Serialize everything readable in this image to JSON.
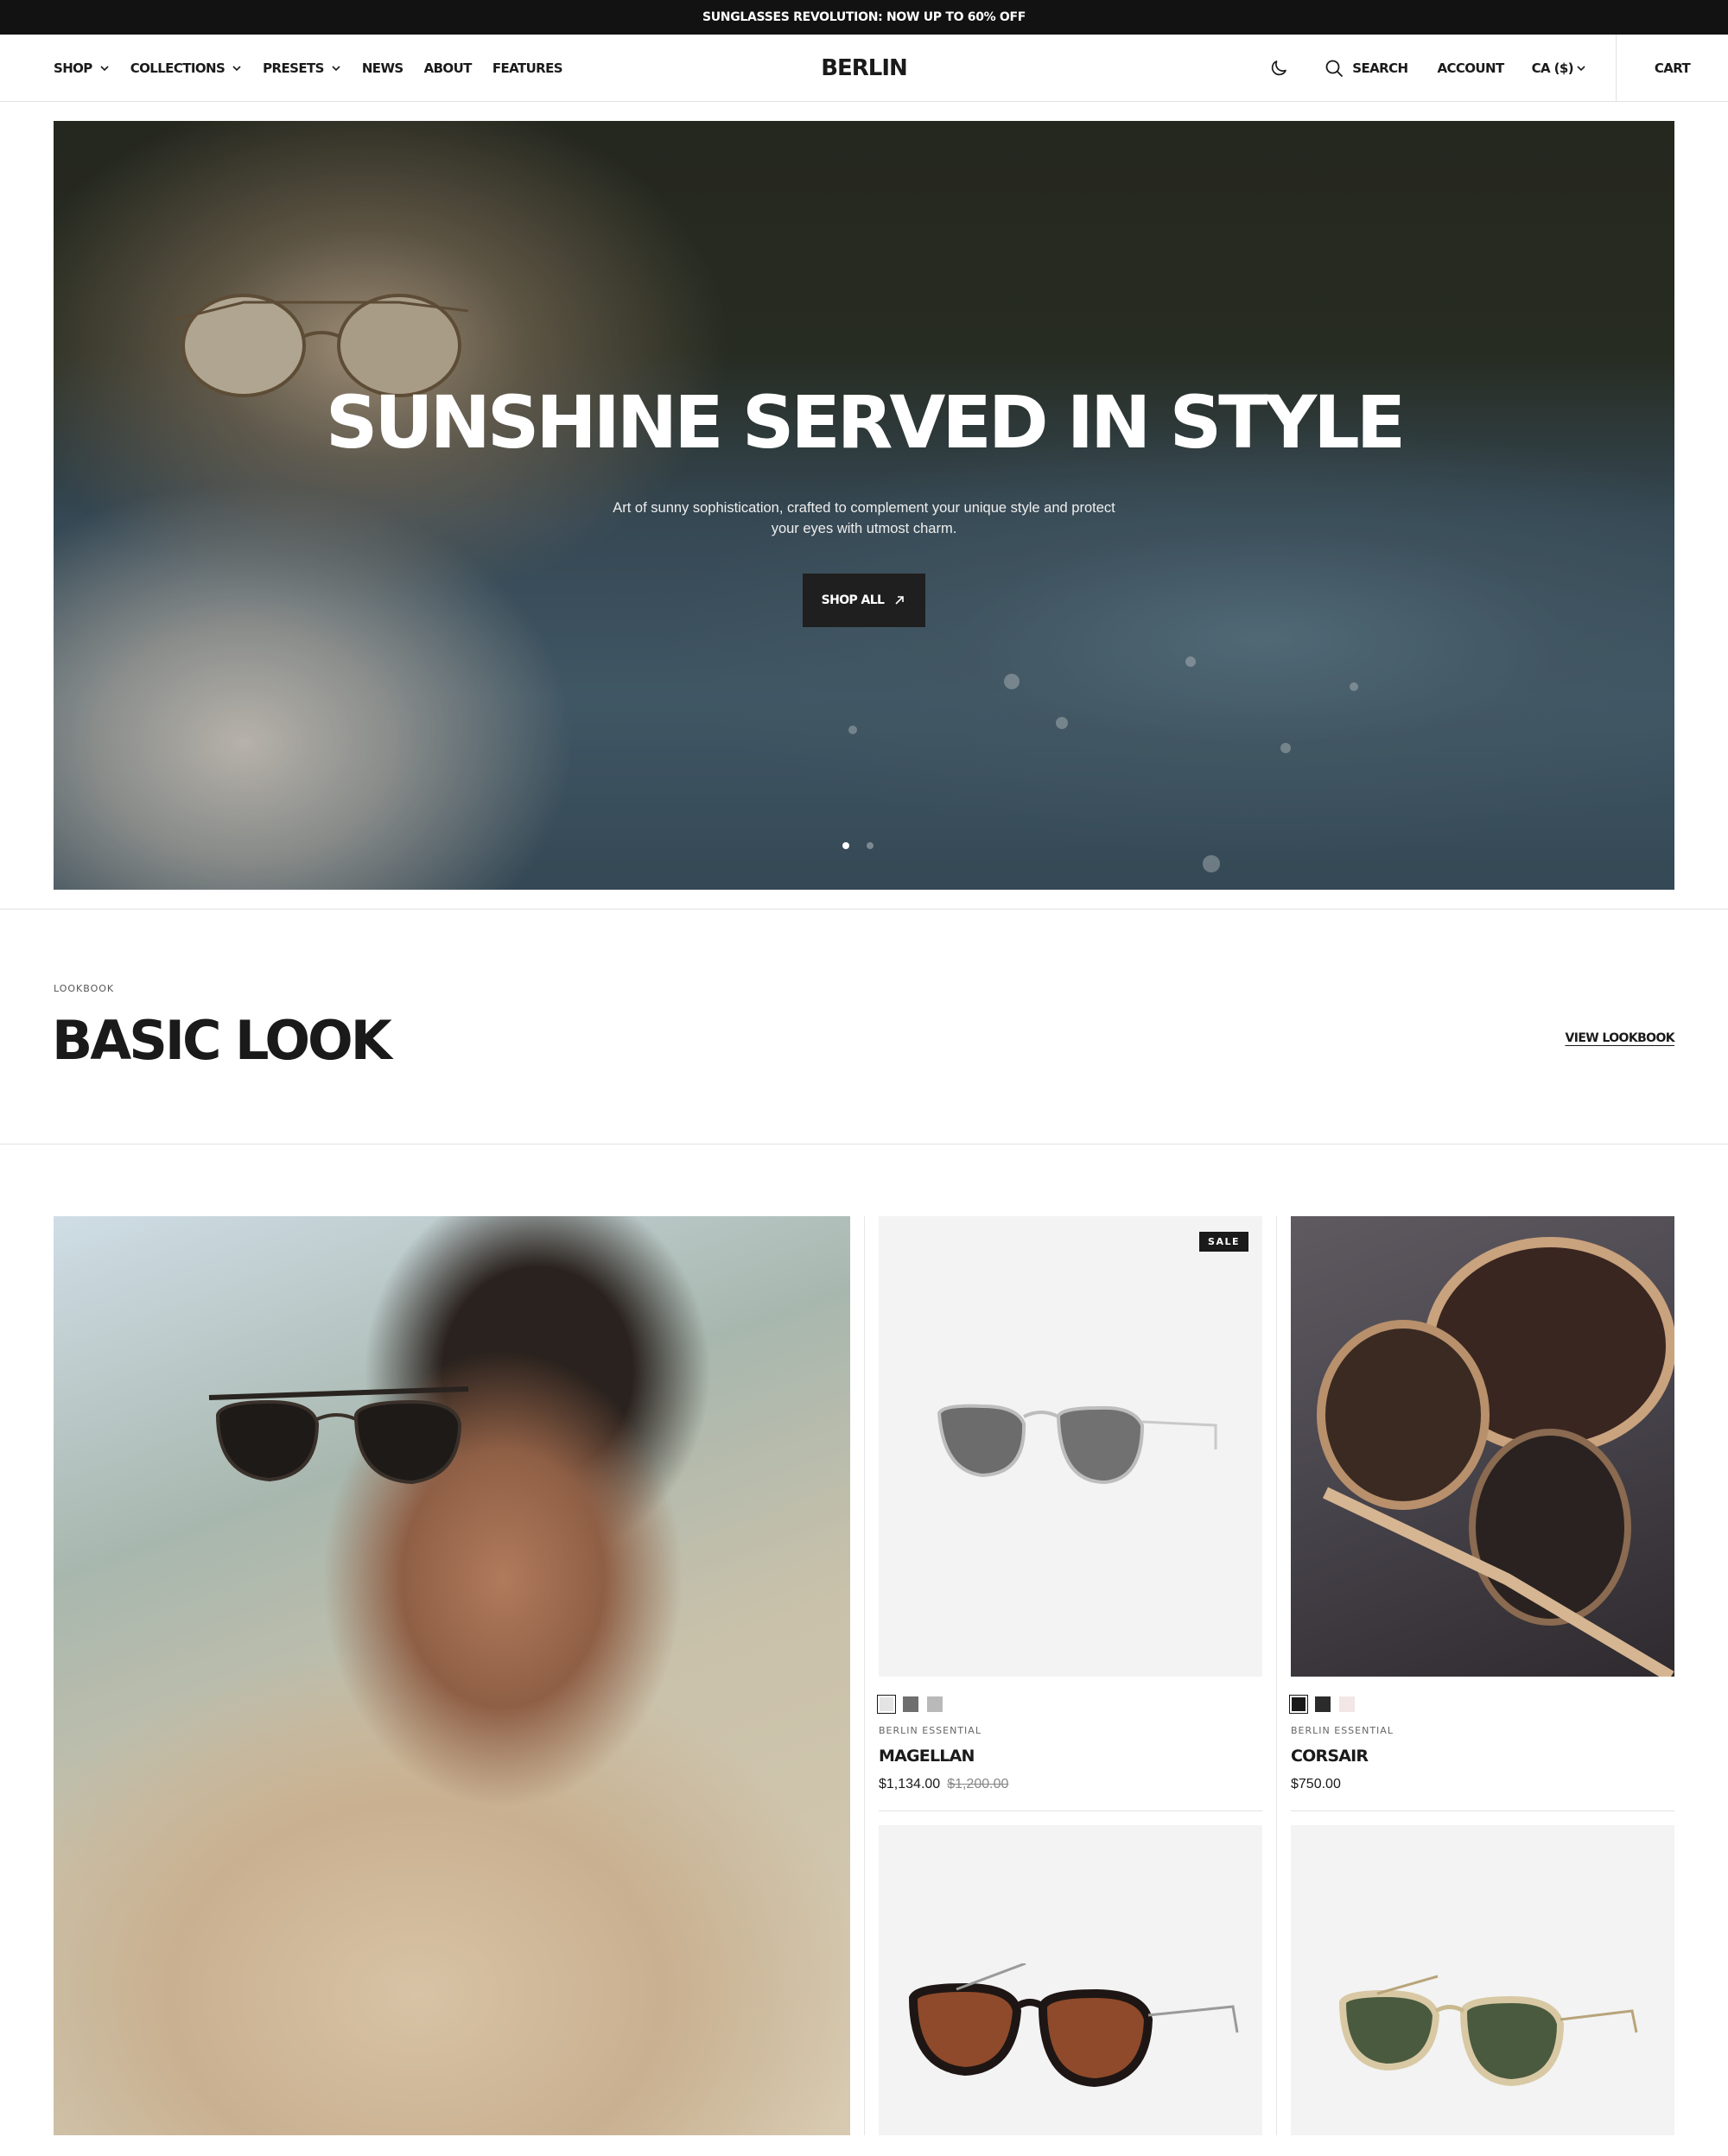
{
  "announcement": "SUNGLASSES REVOLUTION: NOW UP TO 60% OFF",
  "header": {
    "nav_left": [
      {
        "label": "SHOP",
        "dropdown": true
      },
      {
        "label": "COLLECTIONS",
        "dropdown": true
      },
      {
        "label": "PRESETS",
        "dropdown": true
      },
      {
        "label": "NEWS",
        "dropdown": false
      },
      {
        "label": "ABOUT",
        "dropdown": false
      },
      {
        "label": "FEATURES",
        "dropdown": false
      }
    ],
    "logo": "BERLIN",
    "theme_icon": "moon-icon",
    "search_label": "SEARCH",
    "account_label": "ACCOUNT",
    "currency_label": "CA ($)",
    "cart_label": "CART"
  },
  "hero": {
    "title": "SUNSHINE SERVED IN STYLE",
    "subtitle": "Art of sunny sophistication, crafted to complement your unique style and protect your eyes with utmost charm.",
    "button_label": "SHOP ALL",
    "slide_count": 2,
    "active_slide": 1
  },
  "lookbook": {
    "eyebrow": "LOOKBOOK",
    "title": "BASIC LOOK",
    "link_label": "VIEW LOOKBOOK"
  },
  "products": [
    {
      "badge": "SALE",
      "brand": "BERLIN ESSENTIAL",
      "name": "MAGELLAN",
      "price": "$1,134.00",
      "compare_price": "$1,200.00",
      "swatches": [
        "#e4e4e4",
        "#6e6e6e",
        "#b9b9b9"
      ]
    },
    {
      "badge": "",
      "brand": "BERLIN ESSENTIAL",
      "name": "CORSAIR",
      "price": "$750.00",
      "compare_price": "",
      "swatches": [
        "#1a1a1a",
        "#2b2b2b",
        "#f2e6e6"
      ]
    }
  ],
  "colors": {
    "announcement_bg": "#121212",
    "button_bg": "#1f1f1f",
    "card_bg": "#f3f3f3"
  }
}
